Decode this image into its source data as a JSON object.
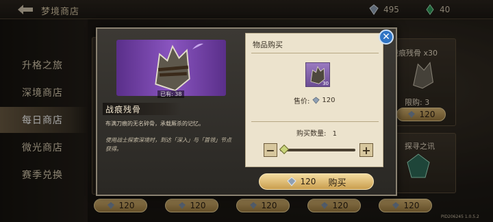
{
  "topbar": {
    "title": "梦境商店",
    "currency": [
      {
        "icon": "crystal-icon",
        "value": "495"
      },
      {
        "icon": "green-gem-icon",
        "value": "40"
      }
    ]
  },
  "sidebar": {
    "items": [
      {
        "label": "升格之旅",
        "active": false
      },
      {
        "label": "深境商店",
        "active": false
      },
      {
        "label": "每日商店",
        "active": true
      },
      {
        "label": "微光商店",
        "active": false
      },
      {
        "label": "赛季兑换",
        "active": false
      }
    ]
  },
  "background_cards": {
    "card_label_1": "战痕残骨 x30",
    "card_limit_1": "限购: 3",
    "card_label_2": "探寻之讯",
    "prices": [
      "120",
      "120",
      "120",
      "120",
      "120",
      "120"
    ]
  },
  "item": {
    "name": "战痕残骨",
    "owned": "已有: 38",
    "description": "布满刀痕的无名碎骨，承载厮杀的记忆。",
    "source_hint": "使用战士探索深境时，到达「深入」与「首领」节点获得。"
  },
  "purchase": {
    "title": "物品购买",
    "thumb_count": "30",
    "unit_price_label": "售价:",
    "unit_price": "120",
    "qty_label": "购买数量:",
    "qty_value": "1",
    "qty_fraction": 0.0
  },
  "buy_button": {
    "price": "120",
    "label": "购买"
  },
  "version": "PID206245 1.0.5.2",
  "colors": {
    "accent_gold": "#d7b573",
    "close_blue": "#2f74c4",
    "item_purple": "#8a55c0"
  }
}
